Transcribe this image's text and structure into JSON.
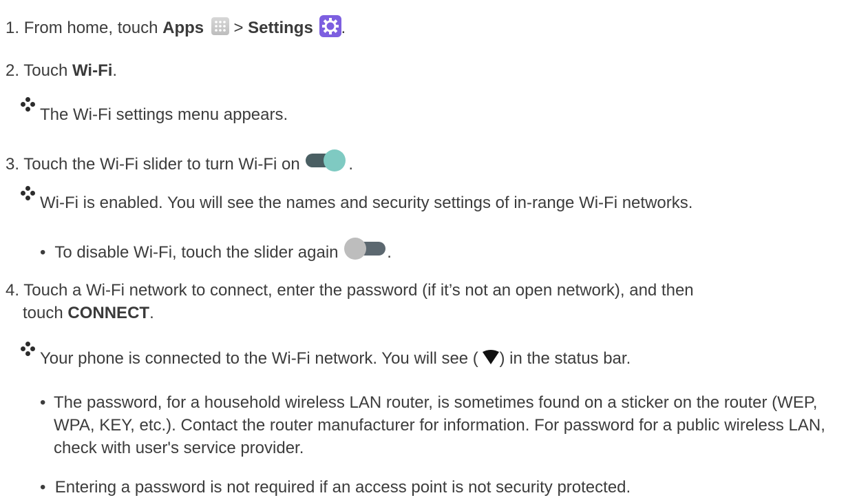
{
  "steps": [
    {
      "number": "1.",
      "pre": "From home, touch ",
      "apps": "Apps",
      "sep": " > ",
      "settings": "Settings",
      "post": "."
    },
    {
      "number": "2.",
      "pre": "Touch ",
      "bold": "Wi-Fi",
      "post": "."
    },
    {
      "number": "3.",
      "text": "Touch the Wi-Fi slider to turn Wi-Fi on",
      "post": "."
    },
    {
      "number": "4.",
      "text": "Touch a Wi-Fi network to connect, enter the password (if it’s not an open network), and then",
      "text2": "touch ",
      "bold": "CONNECT",
      "post": "."
    }
  ],
  "results": {
    "r1": "The Wi-Fi settings menu appears.",
    "r2": "Wi-Fi is enabled. You will see the names and security settings of in-range Wi-Fi networks.",
    "r3_pre": "Your phone is connected to the Wi-Fi network. You will see (",
    "r3_post": ") in the status bar."
  },
  "bullets": {
    "b1": "To disable Wi-Fi, touch the slider again",
    "b1_post": ".",
    "b2": "The password, for a household wireless LAN router, is sometimes found on a sticker on the router (WEP, WPA, KEY, etc.). Contact the router manufacturer for information. For password for a public wireless LAN, check with user's service provider.",
    "b3": "Entering a password is not required if an access point is not security protected."
  },
  "icons": {
    "apps": "apps-grid-icon",
    "settings": "settings-gear-icon",
    "toggle_on": "toggle-on-icon",
    "toggle_off": "toggle-off-icon",
    "wifi": "wifi-signal-icon",
    "result": "diamond-bullet-icon"
  },
  "colors": {
    "settings_icon": "#7d5fe0",
    "toggle_on_track": "#4a5f63",
    "toggle_on_knob": "#7fcac2",
    "toggle_off_knob": "#bdbdbd",
    "toggle_off_track": "#5c6870"
  }
}
